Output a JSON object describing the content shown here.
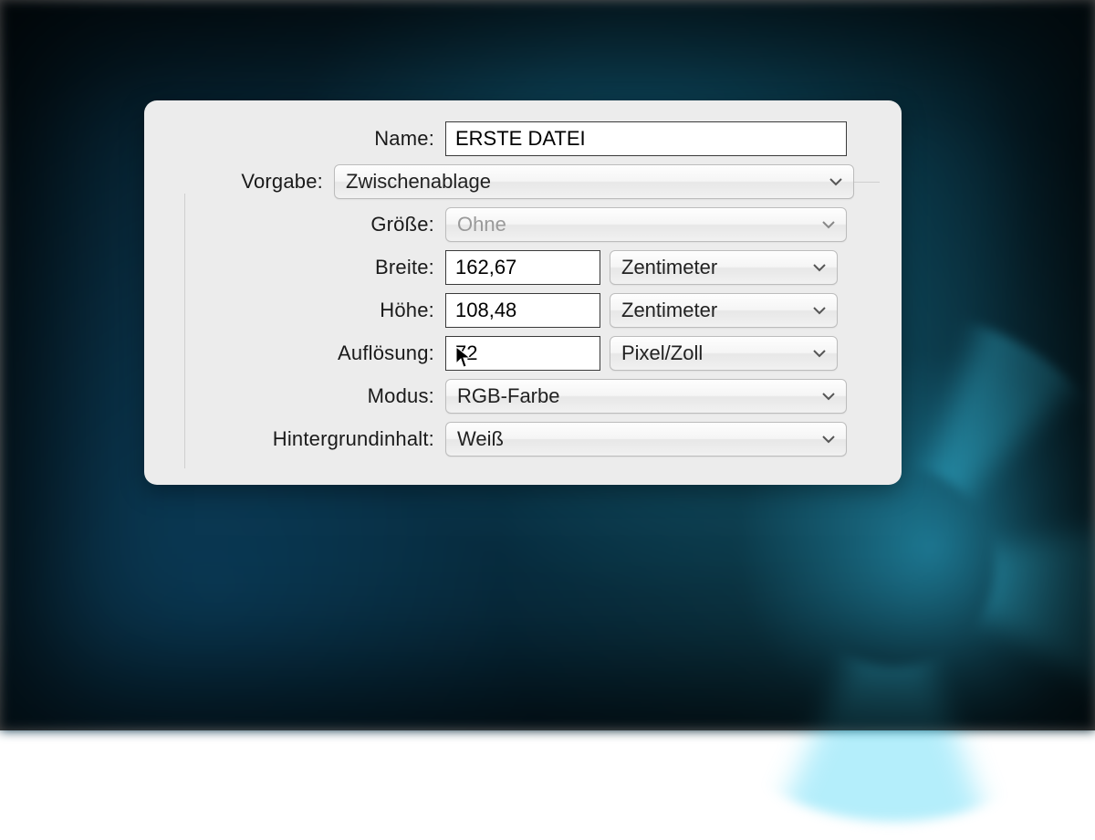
{
  "labels": {
    "name": "Name:",
    "preset": "Vorgabe:",
    "size": "Größe:",
    "width": "Breite:",
    "height": "Höhe:",
    "resolution": "Auflösung:",
    "mode": "Modus:",
    "background": "Hintergrundinhalt:"
  },
  "values": {
    "name": "ERSTE DATEI",
    "preset": "Zwischenablage",
    "size": "Ohne",
    "width": "162,67",
    "height": "108,48",
    "resolution": "72",
    "width_unit": "Zentimeter",
    "height_unit": "Zentimeter",
    "resolution_unit": "Pixel/Zoll",
    "mode": "RGB-Farbe",
    "background": "Weiß"
  }
}
